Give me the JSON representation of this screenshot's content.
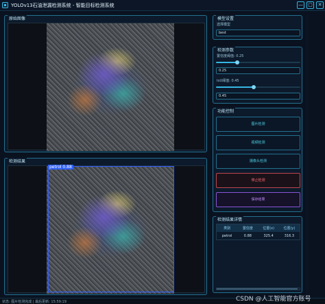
{
  "window": {
    "title": "YOLOv13石油泄漏检测系统 - 智能目标检测系统",
    "controls": [
      "—",
      "▢",
      "✕"
    ]
  },
  "original_panel": {
    "title": "原始图像"
  },
  "result_panel": {
    "title": "检测结果",
    "detection_label": "petrol 0.88"
  },
  "model_settings": {
    "title": "模型设置",
    "select_label": "选择模型",
    "selected_model": "best"
  },
  "detection_params": {
    "title": "检测参数",
    "confidence_label": "置信度阈值: 0.25",
    "confidence_value": "0.25",
    "confidence_level": 0.25,
    "iou_label": "IoU阈值: 0.45",
    "iou_value": "0.45",
    "iou_level": 0.45
  },
  "functions": {
    "title": "功能控制",
    "image_button": "图片检测",
    "video_button": "视频检测",
    "camera_button": "摄像头检测",
    "stop_button": "停止检测",
    "save_button": "保存结果"
  },
  "details": {
    "title": "检测结果详情",
    "columns": [
      "类别",
      "置信度",
      "位置(x)",
      "位置(y)"
    ],
    "rows": [
      [
        "petrol",
        "0.88",
        "325.4",
        "316.3"
      ]
    ]
  },
  "status": {
    "text": "状态: 图片检测完成 | 最后更新: 15:59:19"
  },
  "watermark": "CSDN @人工智能官方账号",
  "colors": {
    "accent": "#36b7e3",
    "stop": "#c0454f",
    "save": "#8a55d6",
    "bbox": "#3060ff"
  }
}
